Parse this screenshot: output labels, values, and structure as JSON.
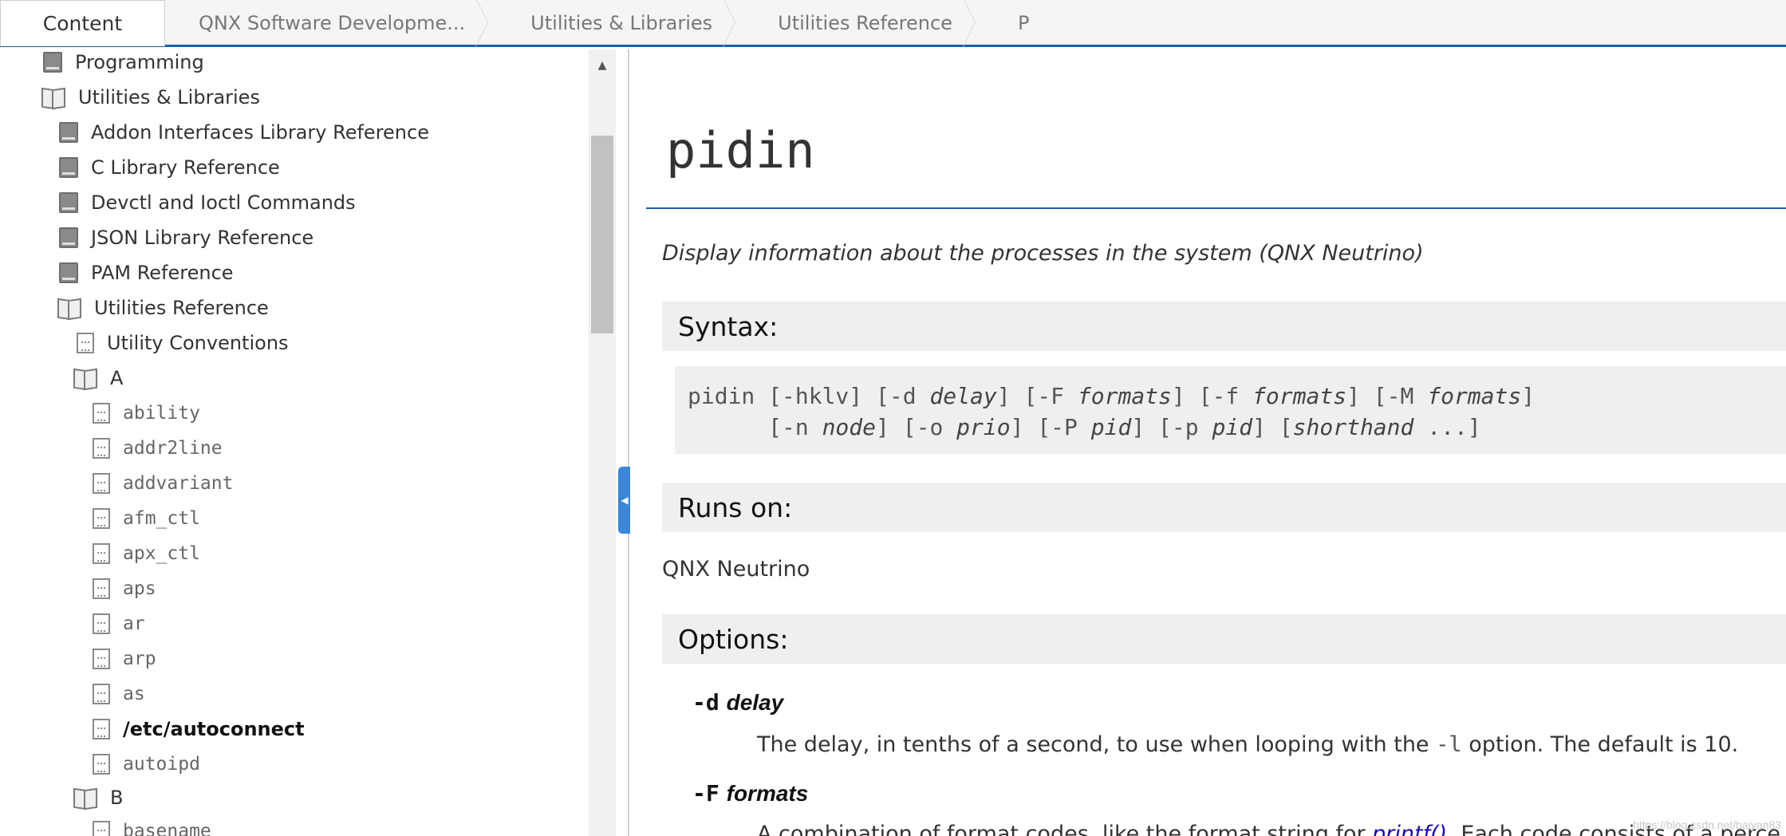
{
  "header": {
    "content_tab": "Content",
    "breadcrumbs": [
      "QNX Software Developme...",
      "Utilities & Libraries",
      "Utilities Reference",
      "P"
    ]
  },
  "sidebar": {
    "items": [
      {
        "label": "Programming",
        "icon": "closed-book-icon"
      },
      {
        "label": "Utilities & Libraries",
        "icon": "open-book-icon"
      },
      {
        "label": "Addon Interfaces Library Reference",
        "icon": "closed-book-icon"
      },
      {
        "label": "C Library Reference",
        "icon": "closed-book-icon"
      },
      {
        "label": "Devctl and Ioctl Commands",
        "icon": "closed-book-icon"
      },
      {
        "label": "JSON Library Reference",
        "icon": "closed-book-icon"
      },
      {
        "label": "PAM Reference",
        "icon": "closed-book-icon"
      },
      {
        "label": "Utilities Reference",
        "icon": "open-book-icon"
      },
      {
        "label": "Utility Conventions",
        "icon": "page-icon"
      },
      {
        "label": "A",
        "icon": "open-book-icon"
      },
      {
        "label": "ability",
        "icon": "page-icon"
      },
      {
        "label": "addr2line",
        "icon": "page-icon"
      },
      {
        "label": "addvariant",
        "icon": "page-icon"
      },
      {
        "label": "afm_ctl",
        "icon": "page-icon"
      },
      {
        "label": "apx_ctl",
        "icon": "page-icon"
      },
      {
        "label": "aps",
        "icon": "page-icon"
      },
      {
        "label": "ar",
        "icon": "page-icon"
      },
      {
        "label": "arp",
        "icon": "page-icon"
      },
      {
        "label": "as",
        "icon": "page-icon"
      },
      {
        "label": "/etc/autoconnect",
        "icon": "page-icon"
      },
      {
        "label": "autoipd",
        "icon": "page-icon"
      },
      {
        "label": "B",
        "icon": "open-book-icon"
      },
      {
        "label": "basename",
        "icon": "page-icon"
      }
    ]
  },
  "main": {
    "title": "pidin",
    "shortdesc": "Display information about the processes in the system (QNX Neutrino)",
    "syntax_heading": "Syntax:",
    "syntax": {
      "l1_a": "pidin [-hklv] [-d ",
      "l1_delay": "delay",
      "l1_b": "] [-F ",
      "l1_f1": "formats",
      "l1_c": "] [-f ",
      "l1_f2": "formats",
      "l1_d": "] [-M ",
      "l1_f3": "formats",
      "l1_e": "]",
      "l2_a": "      [-n ",
      "l2_node": "node",
      "l2_b": "] [-o ",
      "l2_prio": "prio",
      "l2_c": "] [-P ",
      "l2_pid1": "pid",
      "l2_d": "] [-p ",
      "l2_pid2": "pid",
      "l2_e": "] [",
      "l2_sh": "shorthand",
      "l2_f": " ...]"
    },
    "runs_on_heading": "Runs on:",
    "runs_on": "QNX Neutrino",
    "options_heading": "Options:",
    "options": [
      {
        "flag": "-d",
        "arg": "delay",
        "desc_a": "The delay, in tenths of a second, to use when looping with the ",
        "desc_code": "-l",
        "desc_b": " option. The default is 10."
      },
      {
        "flag": "-F",
        "arg": "formats",
        "desc_a": "A combination of format codes, like the format string for ",
        "desc_link": "printf()",
        "desc_b": ". Each code consists of a perce"
      }
    ]
  },
  "watermark": "https://blog.csdn.net/baiyan83"
}
